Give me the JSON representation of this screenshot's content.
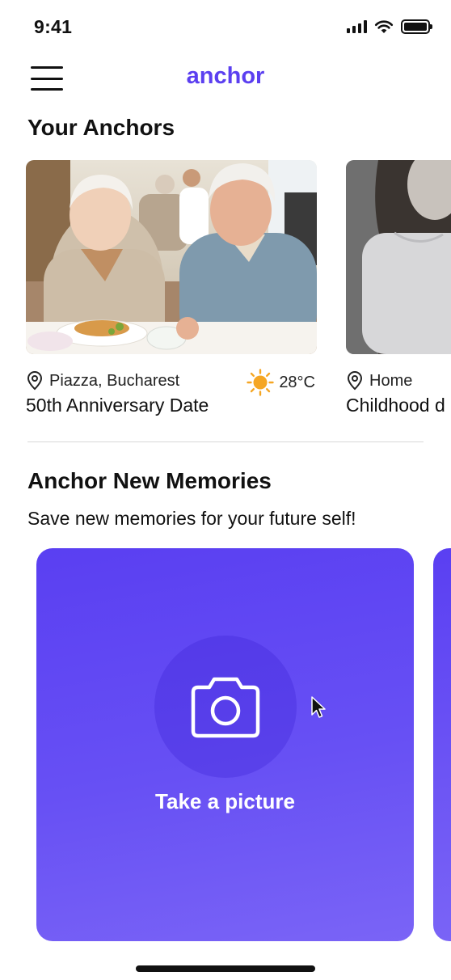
{
  "status_bar": {
    "time": "9:41"
  },
  "nav": {
    "brand": "anchor",
    "menu_icon": "hamburger-menu-icon"
  },
  "your_anchors": {
    "title": "Your Anchors",
    "cards": [
      {
        "location": "Piazza, Bucharest",
        "weather_icon": "sun-icon",
        "temperature": "28°C",
        "title": "50th Anniversary Date"
      },
      {
        "location": "Home",
        "title": "Childhood d"
      }
    ]
  },
  "new_memories": {
    "title": "Anchor New Memories",
    "subtitle": "Save new memories for your future self!",
    "capture_label": "Take a picture",
    "capture_icon": "camera-icon"
  },
  "colors": {
    "brand": "#5b3ff0",
    "card_gradient_start": "#5a3ff2",
    "card_gradient_end": "#7a64f6",
    "sun": "#f5a623"
  }
}
